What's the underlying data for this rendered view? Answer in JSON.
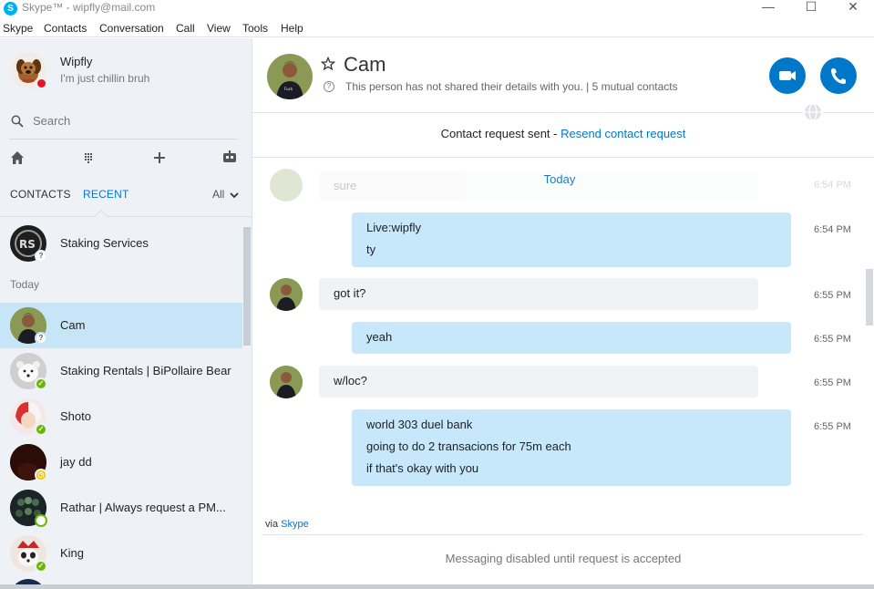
{
  "window": {
    "title": "Skype™ - wipfly@mail.com",
    "logo_letter": "S",
    "minimize": "—",
    "maximize": "☐",
    "close": "✕"
  },
  "menu": [
    "Skype",
    "Contacts",
    "Conversation",
    "Call",
    "View",
    "Tools",
    "Help"
  ],
  "profile": {
    "name": "Wipfly",
    "mood": "I'm just chillin bruh",
    "status": "do-not-disturb"
  },
  "search": {
    "placeholder": "Search"
  },
  "toolbar_icons": [
    "home-icon",
    "dialpad-icon",
    "add-icon",
    "bot-icon"
  ],
  "tabs": {
    "contacts": "CONTACTS",
    "recent": "RECENT",
    "filter": "All"
  },
  "sections": {
    "today": "Today"
  },
  "contacts": [
    {
      "name": "Staking Services",
      "status": "unknown",
      "status_glyph": "?",
      "avatar": "rs-logo"
    },
    {
      "name": "Cam",
      "status": "unknown",
      "status_glyph": "?",
      "avatar": "photo-man",
      "selected": true
    },
    {
      "name": "Staking Rentals | BiPollaire Bear",
      "status": "online",
      "status_glyph": "✓",
      "avatar": "photo-bear"
    },
    {
      "name": "Shoto",
      "status": "online",
      "status_glyph": "✓",
      "avatar": "anime"
    },
    {
      "name": "jay dd",
      "status": "away",
      "status_glyph": "◷",
      "avatar": "dark"
    },
    {
      "name": "Rathar | Always request a PM...",
      "status": "offline",
      "status_glyph": "",
      "avatar": "group"
    },
    {
      "name": "King",
      "status": "online",
      "status_glyph": "✓",
      "avatar": "panda"
    }
  ],
  "chat": {
    "name": "Cam",
    "subtitle": "This person has not shared their details with you.  |  5 mutual contacts",
    "request_text": "Contact request sent - ",
    "request_link": "Resend contact request",
    "ghost_text": "sure",
    "ghost_time": "6:54 PM",
    "today": "Today",
    "messages": [
      {
        "direction": "out",
        "lines": [
          "Live:wipfly",
          "ty"
        ],
        "time": "6:54 PM"
      },
      {
        "direction": "in",
        "lines": [
          "got it?"
        ],
        "time": "6:55 PM"
      },
      {
        "direction": "out",
        "lines": [
          "yeah"
        ],
        "time": "6:55 PM"
      },
      {
        "direction": "in",
        "lines": [
          "w/loc?"
        ],
        "time": "6:55 PM"
      },
      {
        "direction": "out",
        "lines": [
          "world 303 duel bank",
          "going to do 2 transacions for 75m each",
          "if that's okay with you"
        ],
        "time": "6:55 PM"
      }
    ],
    "via": "via ",
    "via_link": "Skype",
    "disabled_notice": "Messaging disabled until request is accepted"
  },
  "colors": {
    "accent": "#0078ca",
    "selected_row": "#c6e6f8",
    "outgoing_bubble": "#c7e8fa",
    "incoming_bubble": "#f0f2f5",
    "online": "#6bb700",
    "away": "#f8c300",
    "busy": "#e81123"
  }
}
